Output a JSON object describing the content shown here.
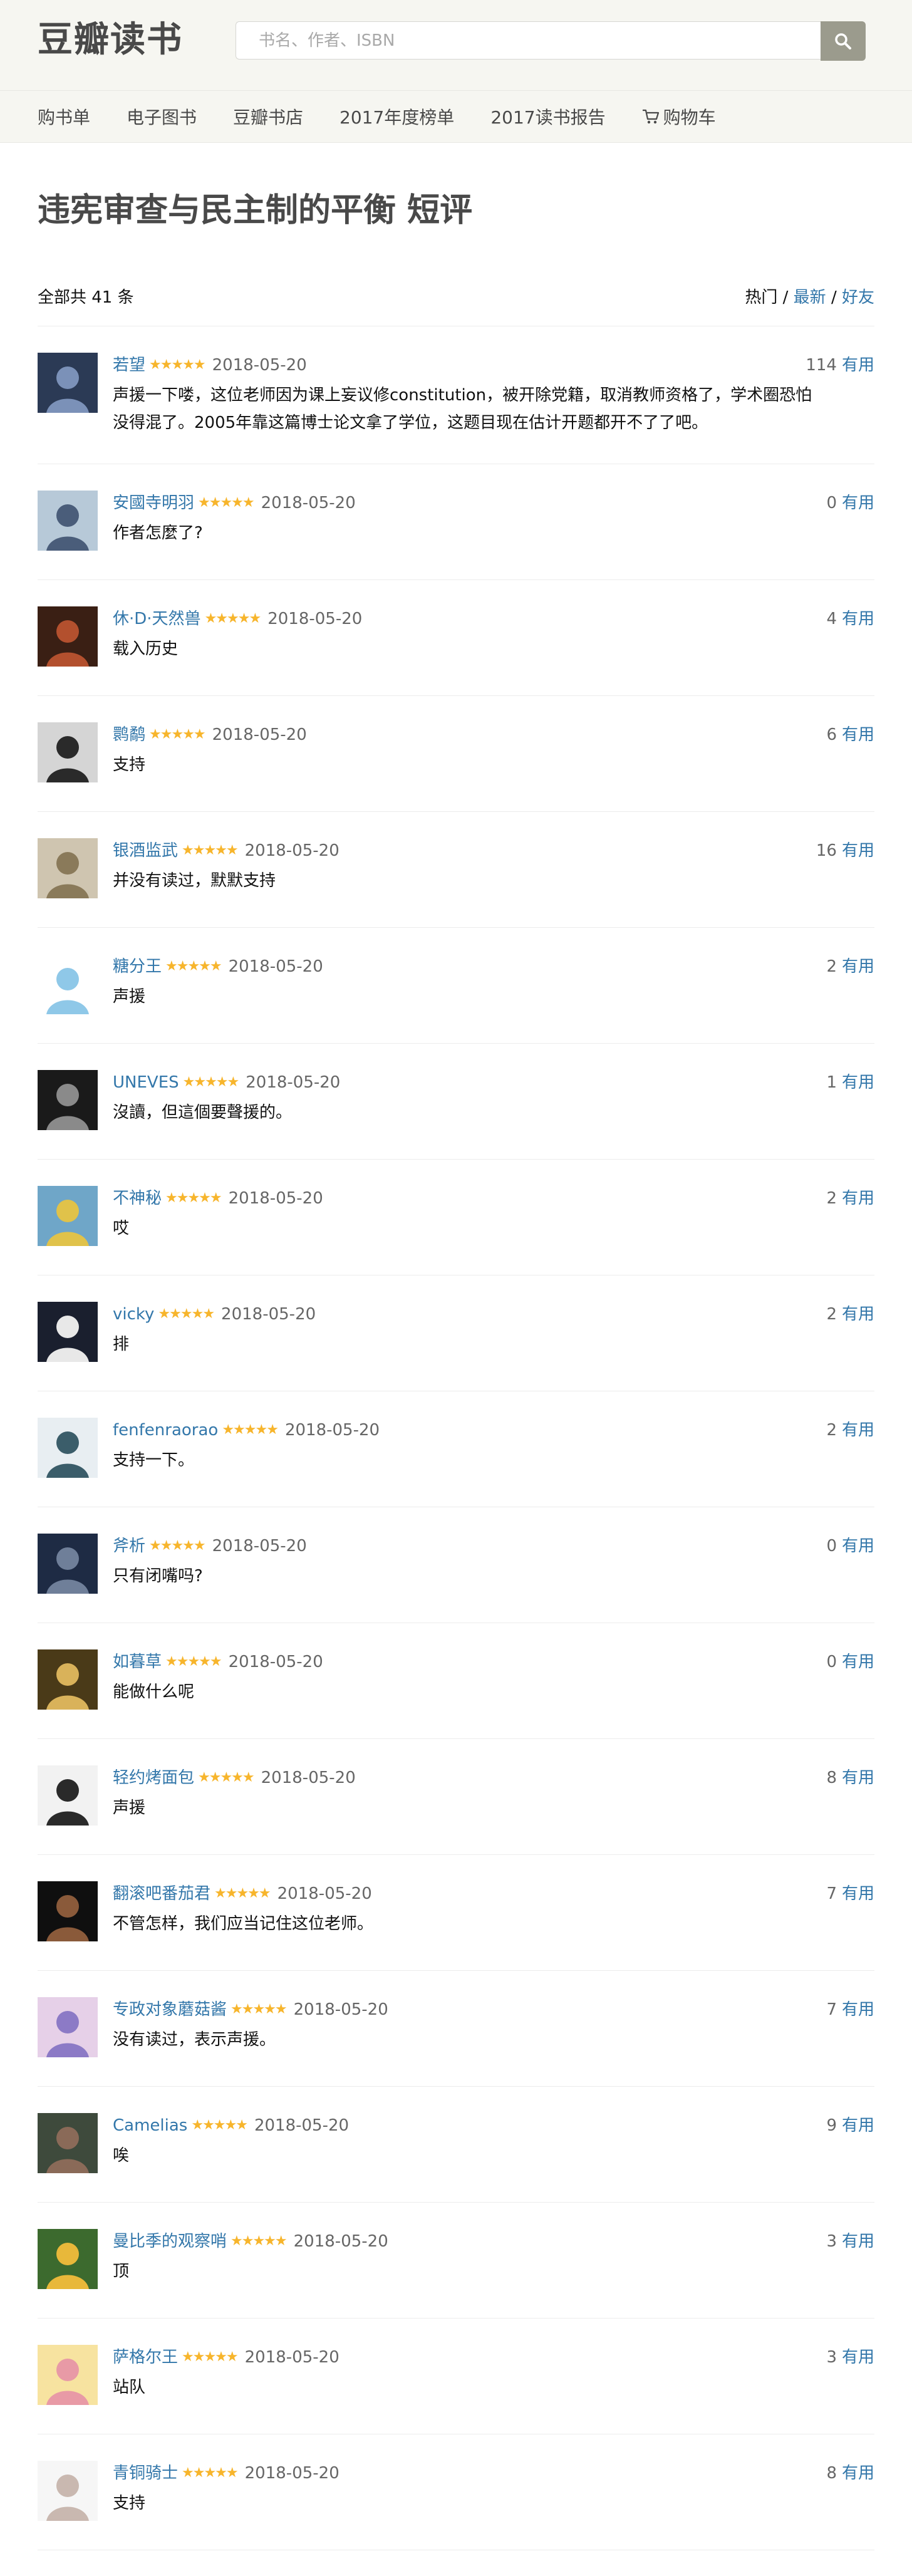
{
  "header": {
    "logo": "豆瓣读书",
    "search_placeholder": "书名、作者、ISBN",
    "search_icon": "magnifier-icon"
  },
  "nav": {
    "items": [
      "购书单",
      "电子图书",
      "豆瓣书店",
      "2017年度榜单",
      "2017读书报告",
      "购物车"
    ],
    "cart_icon": "cart-icon"
  },
  "page": {
    "title": "违宪审查与民主制的平衡 短评",
    "total": "全部共 41 条",
    "sort": {
      "hot": "热门",
      "separator": "/",
      "latest": "最新",
      "friends": "好友"
    }
  },
  "vote_label": "有用",
  "rating_stars": "★★★★★",
  "rating_color": "#f7b52c",
  "link_color": "#3377aa",
  "comments": [
    {
      "user": "若望",
      "date": "2018-05-20",
      "votes": "114",
      "text": "声援一下喽，这位老师因为课上妄议修constitution，被开除党籍，取消教师资格了，学术圈恐怕没得混了。2005年靠这篇博士论文拿了学位，这题目现在估计开题都开不了了吧。",
      "avatar_colors": [
        "#2b3a55",
        "#7b91b8"
      ]
    },
    {
      "user": "安國寺明羽",
      "date": "2018-05-20",
      "votes": "0",
      "text": "作者怎麼了?",
      "avatar_colors": [
        "#b7c9d8",
        "#4a5d7a"
      ]
    },
    {
      "user": "休·D·天然兽",
      "date": "2018-05-20",
      "votes": "4",
      "text": "载入历史",
      "avatar_colors": [
        "#3a1f14",
        "#b3502e"
      ]
    },
    {
      "user": "鹮鹬",
      "date": "2018-05-20",
      "votes": "6",
      "text": "支持",
      "avatar_colors": [
        "#d5d5d5",
        "#2a2a2a"
      ]
    },
    {
      "user": "银酒监武",
      "date": "2018-05-20",
      "votes": "16",
      "text": "并没有读过，默默支持",
      "avatar_colors": [
        "#cfc5b0",
        "#8a7a5a"
      ]
    },
    {
      "user": "糖分王",
      "date": "2018-05-20",
      "votes": "2",
      "text": "声援",
      "avatar_colors": [
        "#ffffff",
        "#8fc8e8"
      ]
    },
    {
      "user": "UNEVES",
      "date": "2018-05-20",
      "votes": "1",
      "text": "沒讀，但這個要聲援的。",
      "avatar_colors": [
        "#1a1a1a",
        "#8a8a8a"
      ]
    },
    {
      "user": "不神秘",
      "date": "2018-05-20",
      "votes": "2",
      "text": "哎",
      "avatar_colors": [
        "#6fa6c8",
        "#e0c24a"
      ]
    },
    {
      "user": "vicky",
      "date": "2018-05-20",
      "votes": "2",
      "text": "排",
      "avatar_colors": [
        "#1a1f2e",
        "#e8e8e8"
      ]
    },
    {
      "user": "fenfenraorao",
      "date": "2018-05-20",
      "votes": "2",
      "text": "支持一下。",
      "avatar_colors": [
        "#e8eef2",
        "#3b5d6a"
      ]
    },
    {
      "user": "斧析",
      "date": "2018-05-20",
      "votes": "0",
      "text": "只有闭嘴吗?",
      "avatar_colors": [
        "#1e2b44",
        "#6f7f99"
      ]
    },
    {
      "user": "如暮草",
      "date": "2018-05-20",
      "votes": "0",
      "text": "能做什么呢",
      "avatar_colors": [
        "#4a3a18",
        "#d9b25a"
      ]
    },
    {
      "user": "轻约烤面包",
      "date": "2018-05-20",
      "votes": "8",
      "text": "声援",
      "avatar_colors": [
        "#f2f2f2",
        "#2a2a2a"
      ]
    },
    {
      "user": "翻滚吧番茄君",
      "date": "2018-05-20",
      "votes": "7",
      "text": "不管怎样，我们应当记住这位老师。",
      "avatar_colors": [
        "#0f0f0f",
        "#8a5a3a"
      ]
    },
    {
      "user": "专政对象蘑菇酱",
      "date": "2018-05-20",
      "votes": "7",
      "text": "没有读过，表示声援。",
      "avatar_colors": [
        "#e6d0e8",
        "#8c7ac6"
      ]
    },
    {
      "user": "Camelias",
      "date": "2018-05-20",
      "votes": "9",
      "text": "唉",
      "avatar_colors": [
        "#3e4a3c",
        "#8a6a58"
      ]
    },
    {
      "user": "曼比季的观察哨",
      "date": "2018-05-20",
      "votes": "3",
      "text": "顶",
      "avatar_colors": [
        "#3c6a2e",
        "#e8b83a"
      ]
    },
    {
      "user": "萨格尔王",
      "date": "2018-05-20",
      "votes": "3",
      "text": "站队",
      "avatar_colors": [
        "#f7e3a0",
        "#e89aa6"
      ]
    },
    {
      "user": "青铜骑士",
      "date": "2018-05-20",
      "votes": "8",
      "text": "支持",
      "avatar_colors": [
        "#f6f6f6",
        "#c9b8b0"
      ]
    }
  ]
}
